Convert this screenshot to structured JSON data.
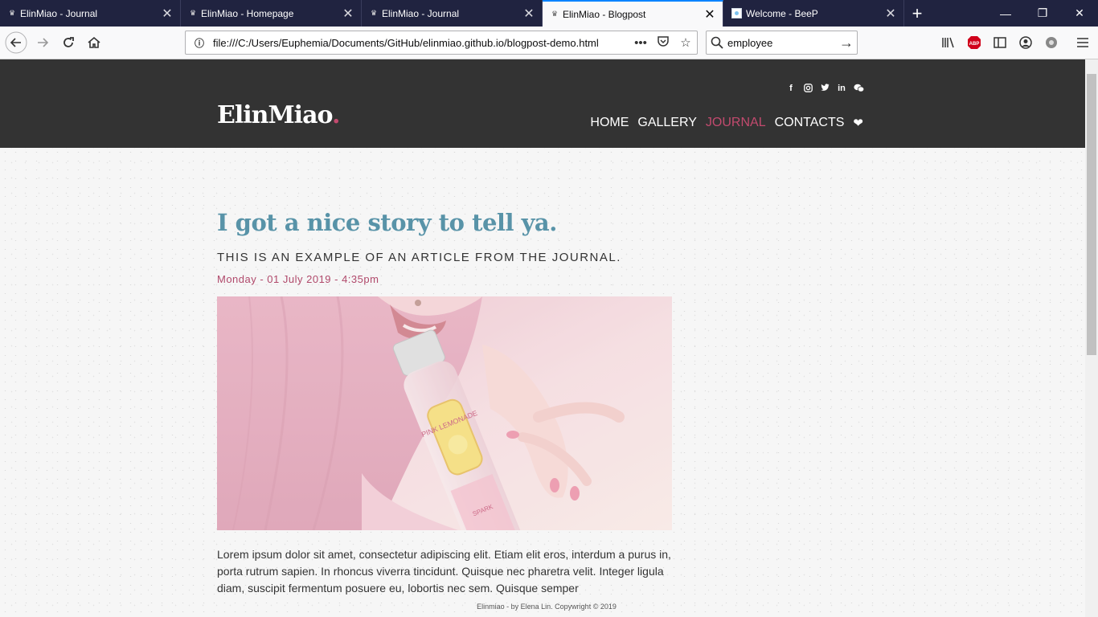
{
  "browser": {
    "tabs": [
      {
        "title": "ElinMiao - Journal",
        "active": false
      },
      {
        "title": "ElinMiao - Homepage",
        "active": false
      },
      {
        "title": "ElinMiao - Journal",
        "active": false
      },
      {
        "title": "ElinMiao - Blogpost",
        "active": true
      },
      {
        "title": "Welcome - BeeP",
        "active": false
      }
    ],
    "url": "file:///C:/Users/Euphemia/Documents/GitHub/elinmiao.github.io/blogpost-demo.html",
    "search_value": "employee",
    "accent_color": "#0a84ff"
  },
  "site": {
    "logo": "ElinMiao",
    "logo_dot": ".",
    "social_icons": [
      "facebook-icon",
      "instagram-icon",
      "twitter-icon",
      "linkedin-icon",
      "wechat-icon"
    ],
    "nav": {
      "home": "HOME",
      "gallery": "GALLERY",
      "journal": "JOURNAL",
      "contacts": "CONTACTS"
    },
    "accent_color": "#c24a6e",
    "header_bg": "#333333"
  },
  "post": {
    "title": "I got a nice story to tell ya.",
    "subtitle": "THIS IS AN EXAMPLE OF AN ARTICLE FROM THE JOURNAL.",
    "date": "Monday - 01 July 2019 - 4:35pm",
    "image_bottle_label": "PINK LEMONADE",
    "image_bottle_side": "SPARK",
    "body": "Lorem ipsum dolor sit amet, consectetur adipiscing elit. Etiam elit eros, interdum a purus in, porta rutrum sapien. In rhoncus viverra tincidunt. Quisque nec pharetra velit. Integer ligula diam, suscipit fermentum posuere eu, lobortis nec sem. Quisque semper"
  },
  "footer": {
    "text": "Elinmiao - by Elena Lin. Copywright © 2019"
  }
}
